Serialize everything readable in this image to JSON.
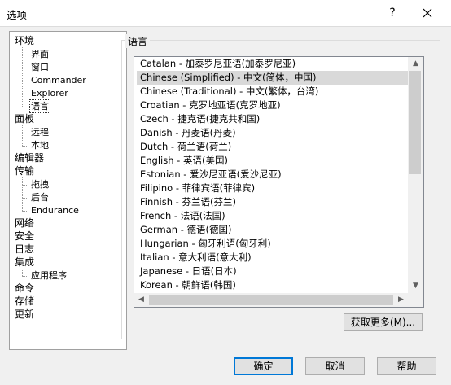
{
  "window": {
    "title": "选项",
    "help_label": "?"
  },
  "tree": {
    "items": [
      {
        "label": "环境",
        "level": 0
      },
      {
        "label": "界面",
        "level": 1
      },
      {
        "label": "窗口",
        "level": 1
      },
      {
        "label": "Commander",
        "level": 1
      },
      {
        "label": "Explorer",
        "level": 1
      },
      {
        "label": "语言",
        "level": 1,
        "selected": true
      },
      {
        "label": "面板",
        "level": 0
      },
      {
        "label": "远程",
        "level": 1
      },
      {
        "label": "本地",
        "level": 1
      },
      {
        "label": "编辑器",
        "level": 0
      },
      {
        "label": "传输",
        "level": 0
      },
      {
        "label": "拖拽",
        "level": 1
      },
      {
        "label": "后台",
        "level": 1
      },
      {
        "label": "Endurance",
        "level": 1
      },
      {
        "label": "网络",
        "level": 0
      },
      {
        "label": "安全",
        "level": 0
      },
      {
        "label": "日志",
        "level": 0
      },
      {
        "label": "集成",
        "level": 0
      },
      {
        "label": "应用程序",
        "level": 1
      },
      {
        "label": "命令",
        "level": 0
      },
      {
        "label": "存储",
        "level": 0
      },
      {
        "label": "更新",
        "level": 0
      }
    ]
  },
  "language_group": {
    "title": "语言",
    "languages": [
      "Catalan - 加泰罗尼亚语(加泰罗尼亚)",
      "Chinese (Simplified) - 中文(简体，中国)",
      "Chinese (Traditional) - 中文(繁体，台湾)",
      "Croatian - 克罗地亚语(克罗地亚)",
      "Czech - 捷克语(捷克共和国)",
      "Danish - 丹麦语(丹麦)",
      "Dutch - 荷兰语(荷兰)",
      "English - 英语(美国)",
      "Estonian - 爱沙尼亚语(爱沙尼亚)",
      "Filipino - 菲律宾语(菲律宾)",
      "Finnish - 芬兰语(芬兰)",
      "French - 法语(法国)",
      "German - 德语(德国)",
      "Hungarian - 匈牙利语(匈牙利)",
      "Italian - 意大利语(意大利)",
      "Japanese - 日语(日本)",
      "Korean - 朝鲜语(韩国)"
    ],
    "selected_index": 1,
    "get_more_label": "获取更多(M)..."
  },
  "buttons": {
    "ok": "确定",
    "cancel": "取消",
    "help": "帮助"
  }
}
